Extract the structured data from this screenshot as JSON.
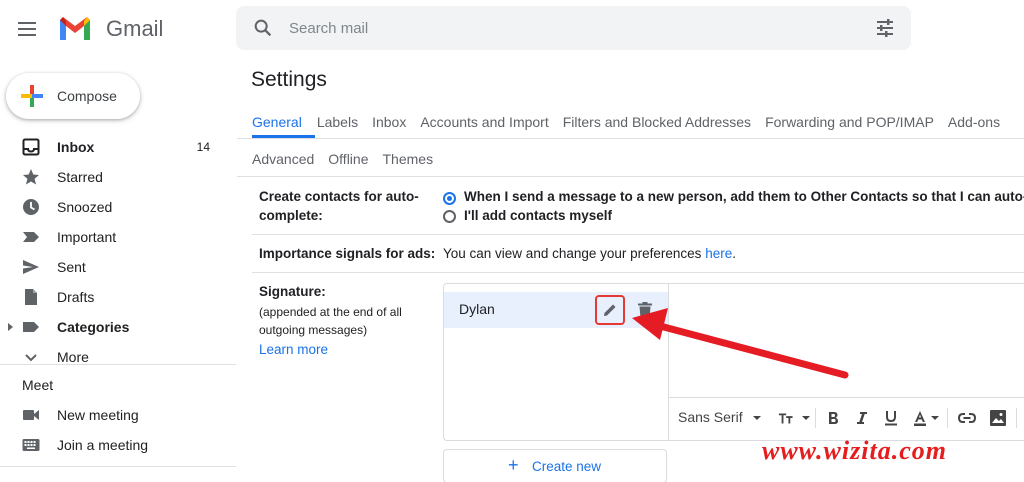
{
  "app": {
    "logo_text": "Gmail"
  },
  "search": {
    "placeholder": "Search mail"
  },
  "compose": {
    "label": "Compose"
  },
  "sidebar": {
    "items": [
      {
        "label": "Inbox",
        "count": "14",
        "icon": "inbox-icon"
      },
      {
        "label": "Starred",
        "icon": "star-icon"
      },
      {
        "label": "Snoozed",
        "icon": "clock-icon"
      },
      {
        "label": "Important",
        "icon": "important-icon"
      },
      {
        "label": "Sent",
        "icon": "send-icon"
      },
      {
        "label": "Drafts",
        "icon": "draft-icon"
      },
      {
        "label": "Categories",
        "icon": "label-icon"
      },
      {
        "label": "More",
        "icon": "chevron-down-icon"
      }
    ],
    "meet": {
      "title": "Meet",
      "items": [
        {
          "label": "New meeting",
          "icon": "video-icon"
        },
        {
          "label": "Join a meeting",
          "icon": "keyboard-icon"
        }
      ]
    }
  },
  "settings": {
    "title": "Settings",
    "tabs_row1": [
      "General",
      "Labels",
      "Inbox",
      "Accounts and Import",
      "Filters and Blocked Addresses",
      "Forwarding and POP/IMAP",
      "Add-ons"
    ],
    "tabs_row2": [
      "Advanced",
      "Offline",
      "Themes"
    ],
    "active_tab": "General",
    "create_contacts": {
      "label_line1": "Create contacts for auto-",
      "label_line2": "complete:",
      "option1": "When I send a message to a new person, add them to Other Contacts so that I can auto-comp",
      "option2": "I'll add contacts myself",
      "selected": "option1"
    },
    "importance": {
      "label": "Importance signals for ads:",
      "text": "You can view and change your preferences",
      "link": "here",
      "suffix": "."
    },
    "signature": {
      "label": "Signature:",
      "sub1": "(appended at the end of all",
      "sub2": "outgoing messages)",
      "learn_more": "Learn more",
      "name": "Dylan",
      "font": "Sans Serif",
      "create_new": "Create new"
    }
  },
  "watermark": "www.wizita.com",
  "colors": {
    "accent": "#1a73e8",
    "highlight": "#e53935",
    "selected_bg": "#e8f0fe"
  }
}
